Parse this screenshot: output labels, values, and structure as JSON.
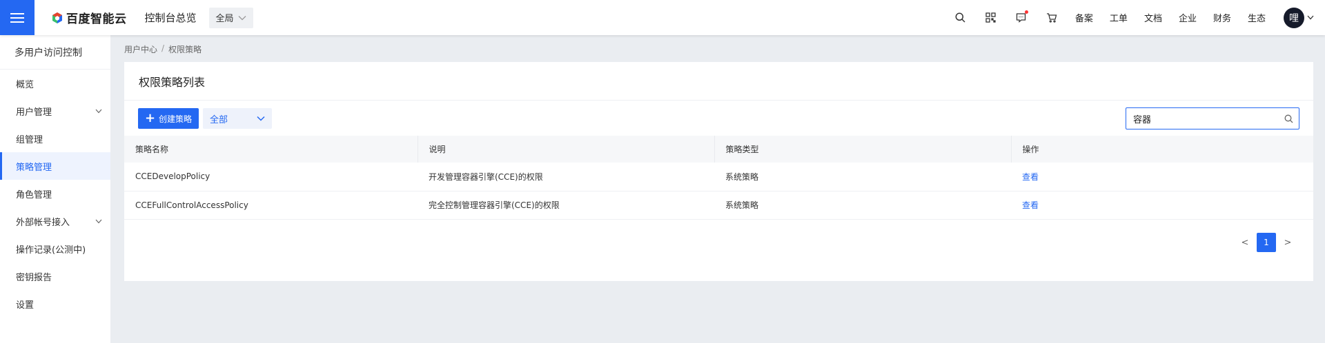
{
  "header": {
    "logo_text": "百度智能云",
    "console_title": "控制台总览",
    "region": "全局",
    "links": [
      "备案",
      "工单",
      "文档",
      "企业",
      "财务",
      "生态"
    ],
    "avatar_text": "哩"
  },
  "sidebar": {
    "title": "多用户访问控制",
    "items": [
      {
        "label": "概览"
      },
      {
        "label": "用户管理"
      },
      {
        "label": "组管理"
      },
      {
        "label": "策略管理"
      },
      {
        "label": "角色管理"
      },
      {
        "label": "外部帐号接入"
      },
      {
        "label": "操作记录(公测中)"
      },
      {
        "label": "密钥报告"
      },
      {
        "label": "设置"
      }
    ]
  },
  "breadcrumb": {
    "parent": "用户中心",
    "separator": "/",
    "current": "权限策略"
  },
  "panel": {
    "title": "权限策略列表",
    "create_label": "创建策略",
    "filter_value": "全部",
    "search_value": "容器"
  },
  "table": {
    "columns": [
      "策略名称",
      "说明",
      "策略类型",
      "操作"
    ],
    "rows": [
      {
        "name": "CCEDevelopPolicy",
        "desc": "开发管理容器引擎(CCE)的权限",
        "type": "系统策略",
        "action": "查看"
      },
      {
        "name": "CCEFullControlAccessPolicy",
        "desc": "完全控制管理容器引擎(CCE)的权限",
        "type": "系统策略",
        "action": "查看"
      }
    ]
  },
  "pagination": {
    "prev": "<",
    "page": "1",
    "next": ">"
  },
  "colors": {
    "accent": "#2468f2",
    "background": "#eaedf1"
  }
}
